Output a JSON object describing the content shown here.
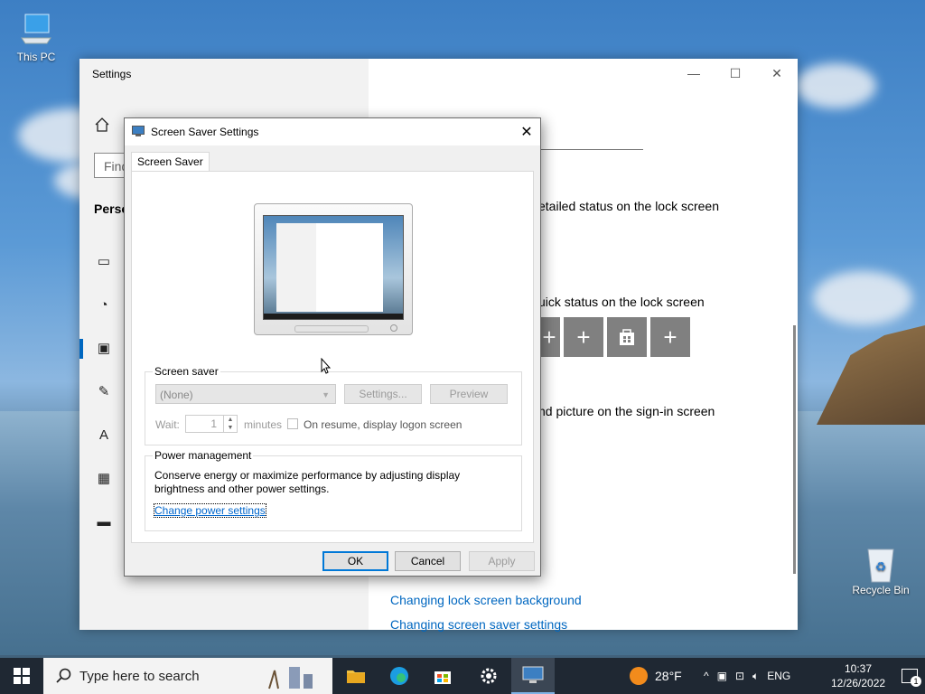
{
  "desktop": {
    "icons": [
      {
        "label": "This PC",
        "icon": "this-pc-icon"
      },
      {
        "label": "Recycle Bin",
        "icon": "recycle-bin-icon"
      }
    ]
  },
  "settings_window": {
    "title": "Settings",
    "search_placeholder": "Find",
    "section_heading": "Perso",
    "content": {
      "detailed_status": "etailed status on the lock screen",
      "quick_status": "uick status on the lock screen",
      "signin_picture": "nd picture on the sign-in screen",
      "links": [
        "Changing lock screen background",
        "Changing screen saver settings"
      ]
    }
  },
  "dialog": {
    "title": "Screen Saver Settings",
    "tab_label": "Screen Saver",
    "screen_saver": {
      "group_label": "Screen saver",
      "selected": "(None)",
      "settings_label": "Settings...",
      "preview_label": "Preview",
      "wait_label": "Wait:",
      "wait_value": "1",
      "minutes_label": "minutes",
      "resume_label": "On resume, display logon screen",
      "resume_checked": false
    },
    "power": {
      "group_label": "Power management",
      "description": "Conserve energy or maximize performance by adjusting display brightness and other power settings.",
      "link": "Change power settings"
    },
    "buttons": {
      "ok": "OK",
      "cancel": "Cancel",
      "apply": "Apply"
    }
  },
  "taskbar": {
    "search_placeholder": "Type here to search",
    "weather": "28°F",
    "language": "ENG",
    "time": "10:37",
    "date": "12/26/2022",
    "notification_count": "1"
  },
  "colors": {
    "accent": "#0078d7",
    "link": "#0067c0",
    "taskbar": "#1f2833"
  }
}
